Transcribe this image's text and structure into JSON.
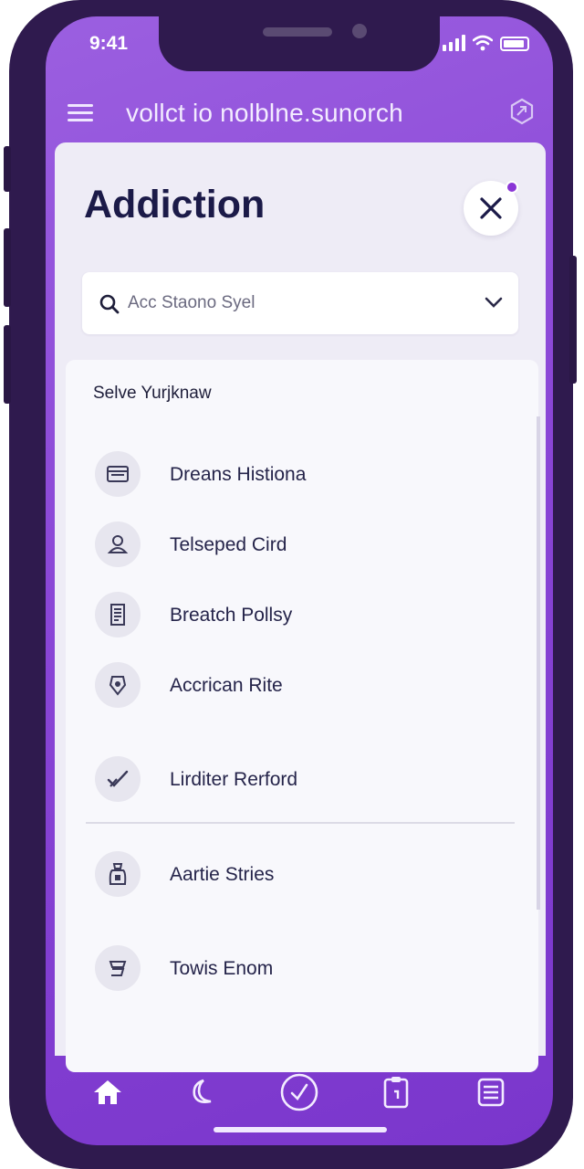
{
  "status": {
    "time": "9:41"
  },
  "header": {
    "title": "vollct io nolblne.sunorch"
  },
  "panel": {
    "heading": "Addiction",
    "search": {
      "value": "Acc Staono Syel"
    }
  },
  "list": {
    "title": "Selve Yurjknaw",
    "items": [
      {
        "label": "Dreans Histiona",
        "icon": "tray-icon"
      },
      {
        "label": "Telseped Cird",
        "icon": "user-icon"
      },
      {
        "label": "Breatch Pollsy",
        "icon": "document-icon"
      },
      {
        "label": "Accrican Rite",
        "icon": "badge-icon"
      },
      {
        "label": "Lirditer Rerford",
        "icon": "check-icon"
      },
      {
        "label": "Aartie Stries",
        "icon": "bag-icon"
      },
      {
        "label": "Towis Enom",
        "icon": "note-icon"
      }
    ]
  },
  "nav": [
    "home-icon",
    "moon-icon",
    "check-circle-icon",
    "clipboard-icon",
    "list-icon"
  ],
  "colors": {
    "accent": "#8a46d6",
    "frame": "#2f1a4e",
    "heading": "#1b1a48"
  }
}
